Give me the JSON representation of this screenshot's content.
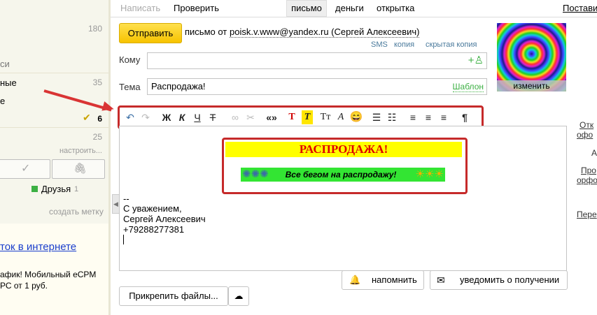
{
  "sidebar": {
    "counts": [
      "180",
      "35",
      "6",
      "25"
    ],
    "labels": [
      "си",
      "ные",
      "е"
    ],
    "setup_label": "настроить...",
    "label_friends": "Друзья",
    "label_friends_count": "1",
    "create_label": "создать метку",
    "ad_title": "ток в интернете",
    "ad_text_1": "афик! Мобильный eCPM",
    "ad_text_2": "РС от 1 руб.",
    "colors": {
      "friends": "#3cb043",
      "ad_link": "#1a3ecc"
    }
  },
  "topbar": {
    "compose": "Написать",
    "check": "Проверить",
    "tab_letter": "письмо",
    "tab_money": "деньги",
    "tab_card": "открытка",
    "right": "Поставить"
  },
  "compose": {
    "send_label": "Отправить",
    "from_prefix": "письмо от",
    "from_address": "poisk.v.www@yandex.ru (Сергей Алексеевич)",
    "sms": "SMS",
    "copy": "копия",
    "hidden_copy": "скрытая копия",
    "to_label": "Кому",
    "to_value": "",
    "subject_label": "Тема",
    "subject_value": "Распродажа!",
    "template_label": "Шаблон",
    "avatar_change": "изменить"
  },
  "toolbar": {
    "bold": "Ж",
    "italic": "К",
    "underline": "Ч",
    "strike": "Т",
    "quote": "«»",
    "text_color": "Т",
    "bg_color": "Т",
    "font_size": "Тт",
    "font_family": "А"
  },
  "editor": {
    "banner_title": "РАСПРОДАЖА!",
    "banner_text": "Все бегом на распродажу!",
    "sig_dash": "--",
    "sig_line1": "С уважением,",
    "sig_line2": "Сергей Алексеевич",
    "sig_line3": "+79288277381"
  },
  "actions": {
    "remind": "напомнить",
    "notify": "уведомить о получении",
    "attach": "Прикрепить файлы..."
  },
  "right_panel": {
    "line1a": "Отк",
    "line1b": "офо",
    "line2": "А",
    "line3a": "Про",
    "line3b": "орфо",
    "line4": "Пере"
  }
}
